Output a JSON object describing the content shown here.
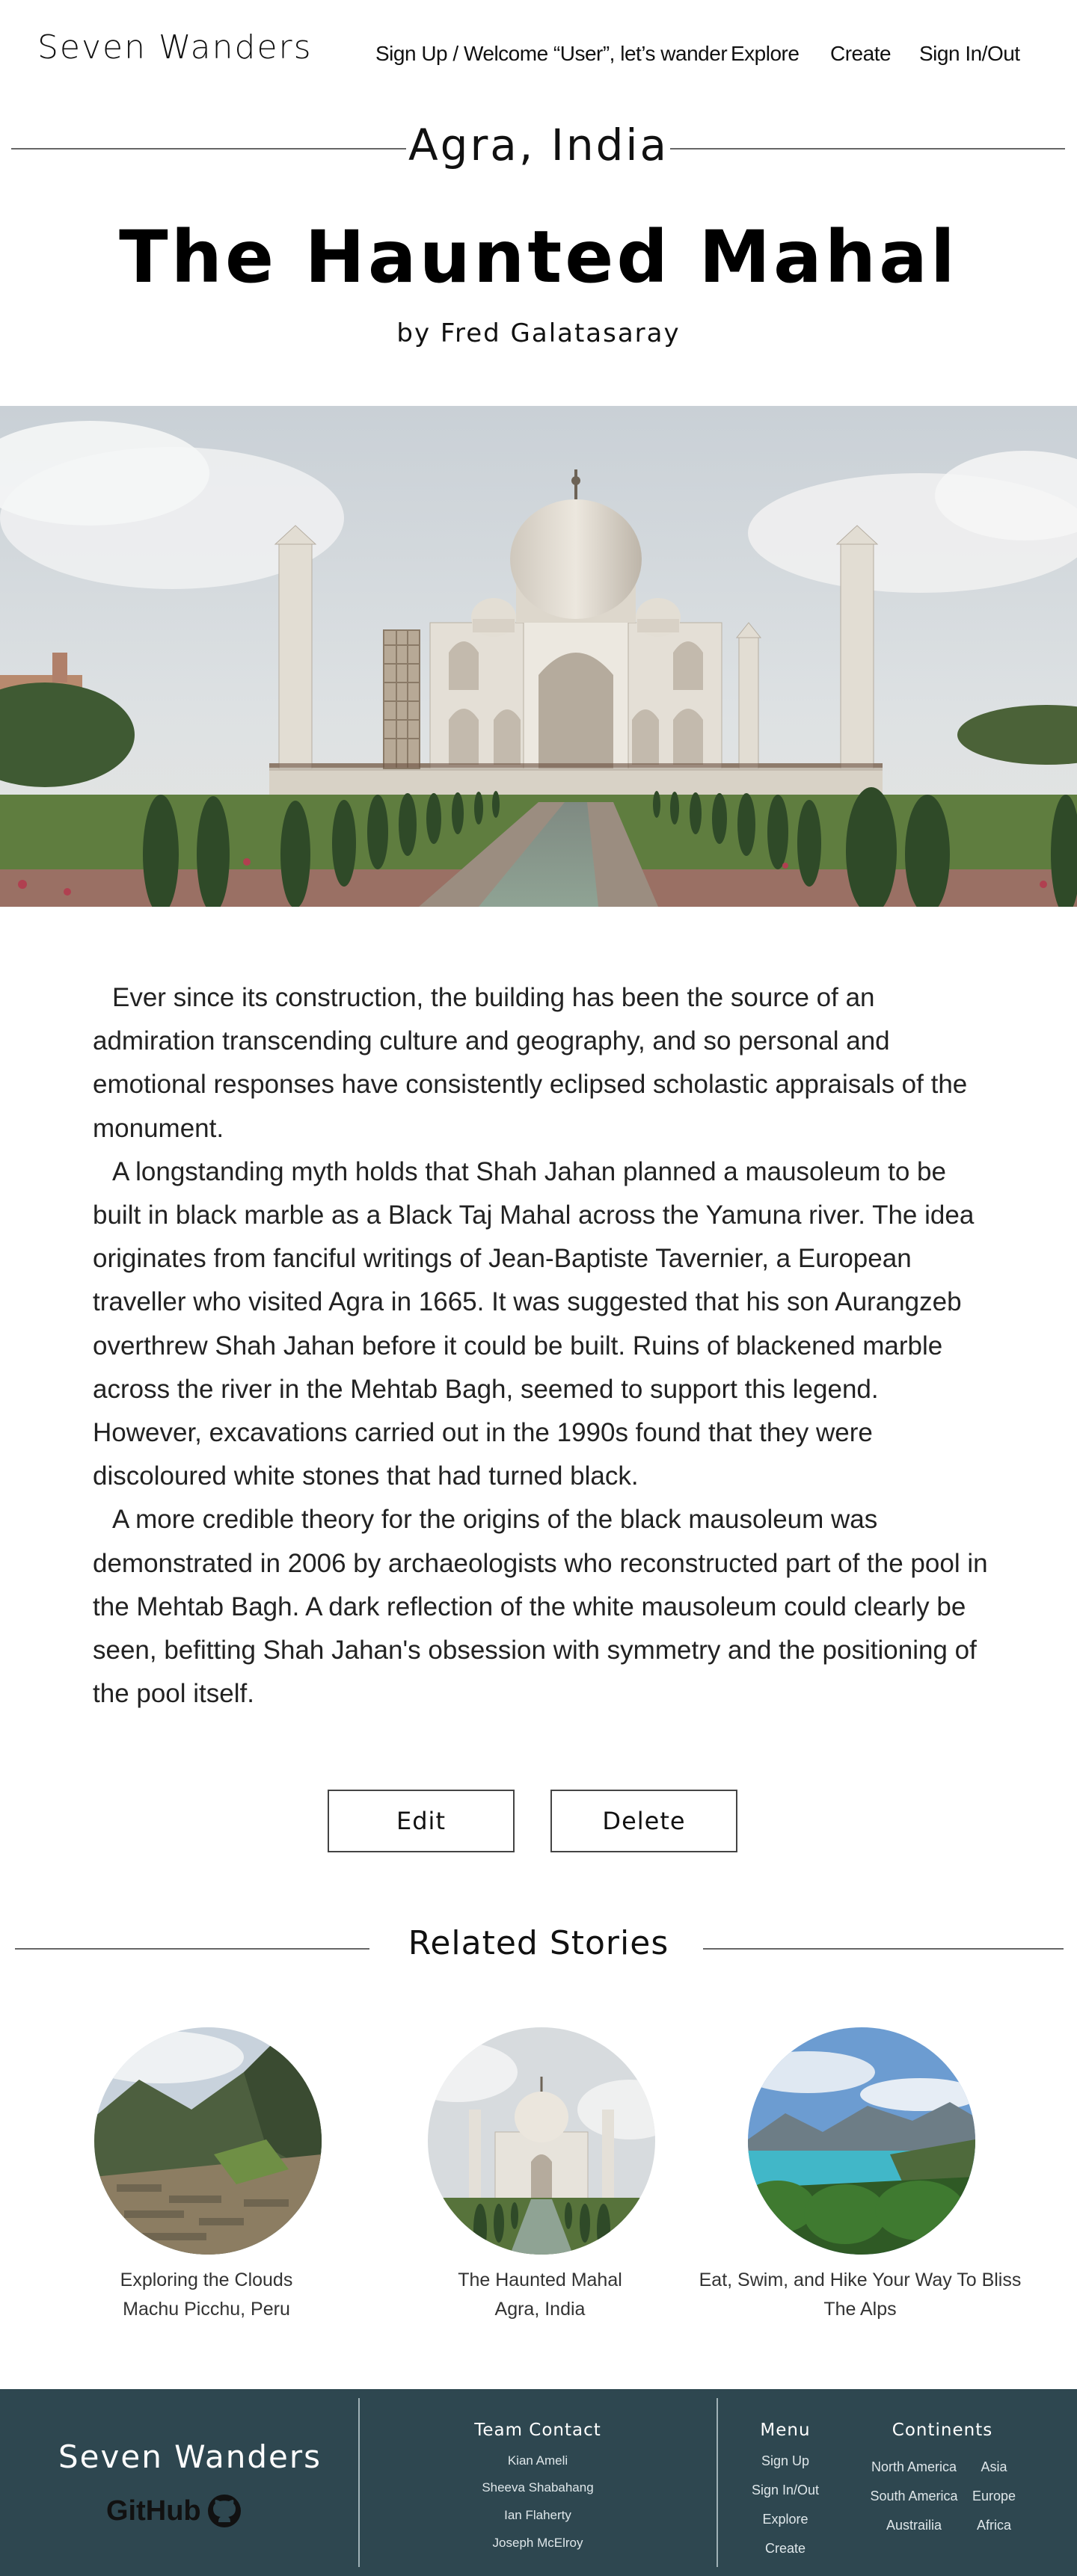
{
  "header": {
    "brand": "Seven Wanders",
    "nav": [
      "Sign Up / Welcome “User”, let’s wander",
      "Explore",
      "Create",
      "Sign In/Out"
    ]
  },
  "story": {
    "location": "Agra, India",
    "title": "The Haunted Mahal",
    "author": "by Fred Galatasaray",
    "hero_image": "taj-mahal-photo",
    "paragraphs": [
      "Ever since its construction, the building has been the source of an admiration transcending culture and geography, and so personal and emotional responses have consistently eclipsed scholastic appraisals of the monument.",
      "A longstanding myth holds that Shah Jahan planned a mausoleum to be built in black marble as a Black Taj Mahal across the Yamuna river. The idea originates from fanciful writings of Jean-Baptiste Tavernier, a European traveller who visited Agra in 1665. It was suggested that his son Aurangzeb overthrew Shah Jahan before it could be built. Ruins of blackened marble across the river in the Mehtab Bagh, seemed to support this legend. However, excavations carried out in the 1990s found that they were discoloured white stones that had turned black.",
      "A more credible theory for the origins of the black mausoleum was demonstrated in 2006 by archaeologists who reconstructed part of the pool in the Mehtab Bagh. A dark reflection of the white mausoleum could clearly be seen, befitting Shah Jahan's obsession with symmetry and the positioning of the pool itself."
    ]
  },
  "actions": {
    "edit": "Edit",
    "delete": "Delete"
  },
  "related": {
    "heading": "Related Stories",
    "items": [
      {
        "title": "Exploring the Clouds",
        "location": "Machu Picchu, Peru",
        "image": "machu-picchu-photo"
      },
      {
        "title": "The Haunted Mahal",
        "location": "Agra, India",
        "image": "taj-mahal-photo"
      },
      {
        "title": "Eat, Swim, and Hike Your Way To Bliss",
        "location": "The Alps",
        "image": "alpine-lake-photo"
      }
    ]
  },
  "footer": {
    "brand": "Seven Wanders",
    "github": "GitHub",
    "team_heading": "Team Contact",
    "team": [
      "Kian Ameli",
      "Sheeva Shabahang",
      "Ian Flaherty",
      "Joseph McElroy"
    ],
    "menu_heading": "Menu",
    "menu": [
      "Sign Up",
      "Sign In/Out",
      "Explore",
      "Create"
    ],
    "continents_heading": "Continents",
    "continents": [
      "North America",
      "Asia",
      "South America",
      "Europe",
      "Austrailia",
      "Africa"
    ],
    "colors": {
      "background": "#2e4750",
      "text": "#ffffff"
    }
  }
}
